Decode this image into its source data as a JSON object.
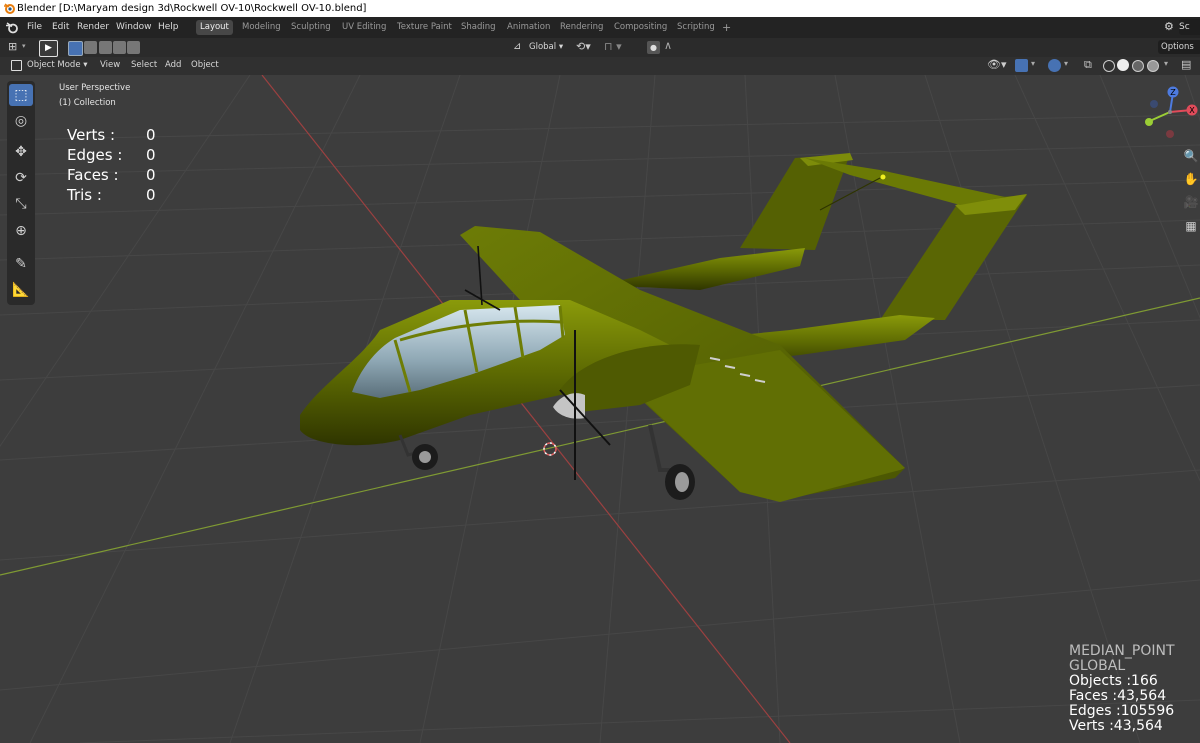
{
  "window": {
    "title": "Blender [D:\\Maryam design 3d\\Rockwell OV-10\\Rockwell OV-10.blend]"
  },
  "menubar": {
    "items": [
      "File",
      "Edit",
      "Render",
      "Window",
      "Help"
    ]
  },
  "workspaces": {
    "tabs": [
      "Layout",
      "Modeling",
      "Sculpting",
      "UV Editing",
      "Texture Paint",
      "Shading",
      "Animation",
      "Rendering",
      "Compositing",
      "Scripting"
    ],
    "active": "Layout",
    "add": "+"
  },
  "topright": {
    "scene_label": "Sc"
  },
  "header": {
    "orientation": "Global",
    "options": "Options"
  },
  "viewport_header": {
    "mode": "Object Mode",
    "menus": [
      "View",
      "Select",
      "Add",
      "Object"
    ]
  },
  "viewport": {
    "perspective": "User Perspective",
    "collection": "(1) Collection",
    "stats": {
      "verts_label": "Verts :",
      "verts": "0",
      "edges_label": "Edges :",
      "edges": "0",
      "faces_label": "Faces :",
      "faces": "0",
      "tris_label": "Tris :",
      "tris": "0"
    },
    "pivot": {
      "point": "MEDIAN_POINT",
      "orientation": "GLOBAL"
    },
    "scene_stats": {
      "objects": "Objects :166",
      "faces": "Faces :43,564",
      "edges": "Edges :105596",
      "verts": "Verts :43,564"
    }
  },
  "gizmo": {
    "z": "Z",
    "y": "Y",
    "x": "X"
  },
  "colors": {
    "accent": "#4772b3",
    "model": "#6b7a05",
    "grid_x": "#b04a4a",
    "grid_y": "#8ba33a",
    "background": "#3d3d3d"
  }
}
